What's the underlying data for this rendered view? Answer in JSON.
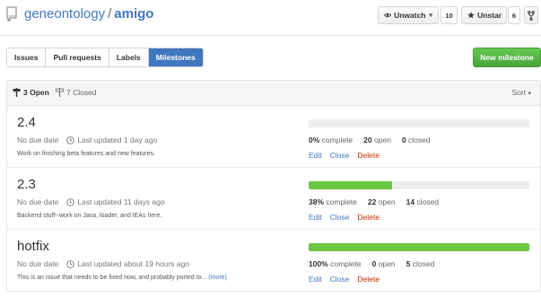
{
  "repo": {
    "owner": "geneontology",
    "separator": "/",
    "name": "amigo"
  },
  "header": {
    "watch_label": "Unwatch",
    "watch_count": "10",
    "star_label": "Unstar",
    "star_count": "6"
  },
  "tabs": [
    {
      "label": "Issues"
    },
    {
      "label": "Pull requests"
    },
    {
      "label": "Labels"
    },
    {
      "label": "Milestones",
      "active": true
    }
  ],
  "new_milestone_label": "New milestone",
  "list_header": {
    "open": "3 Open",
    "closed": "7 Closed",
    "sort": "Sort"
  },
  "milestones": [
    {
      "title": "2.4",
      "due": "No due date",
      "updated": "Last updated 1 day ago",
      "description": "Work on finishing beta features and new features.",
      "more": "",
      "progress": 0,
      "percent_text": "0%",
      "complete_label": "complete",
      "open_count": "20",
      "open_label": "open",
      "closed_count": "0",
      "closed_label": "closed",
      "edit": "Edit",
      "close": "Close",
      "delete": "Delete"
    },
    {
      "title": "2.3",
      "due": "No due date",
      "updated": "Last updated 11 days ago",
      "description": "Backend stuff--work on Java, loader, and IEAs here.",
      "more": "",
      "progress": 38,
      "percent_text": "38%",
      "complete_label": "complete",
      "open_count": "22",
      "open_label": "open",
      "closed_count": "14",
      "closed_label": "closed",
      "edit": "Edit",
      "close": "Close",
      "delete": "Delete"
    },
    {
      "title": "hotfix",
      "due": "No due date",
      "updated": "Last updated about 19 hours ago",
      "description": "This is an issue that needs to be fixed now, and probably ported to...",
      "more": "(more)",
      "progress": 100,
      "percent_text": "100%",
      "complete_label": "complete",
      "open_count": "0",
      "open_label": "open",
      "closed_count": "5",
      "closed_label": "closed",
      "edit": "Edit",
      "close": "Close",
      "delete": "Delete"
    }
  ],
  "colors": {
    "link": "#4078c0",
    "progress": "#6cc644",
    "primary_button": "#55b940",
    "delete": "#bd2c00"
  },
  "icons": [
    "repo-icon",
    "eye-icon",
    "star-icon",
    "fork-icon",
    "milestone-icon",
    "clock-icon",
    "caret-down-icon"
  ]
}
